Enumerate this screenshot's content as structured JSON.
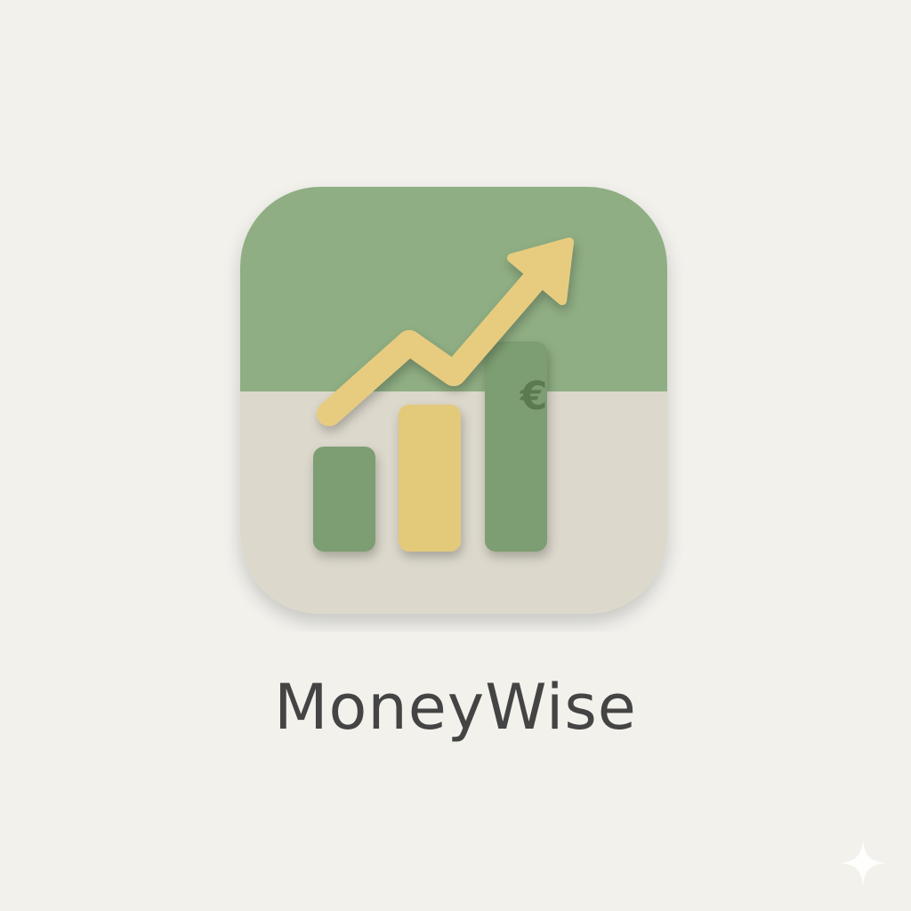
{
  "app": {
    "name": "MoneyWise",
    "currency_symbol": "€"
  },
  "icon": {
    "motif": "bar-chart-with-rising-arrow-icon",
    "currency_icon": "euro-icon",
    "corner_icon": "sparkle-icon"
  },
  "chart_data": {
    "type": "bar",
    "categories": [
      "",
      "",
      ""
    ],
    "values": [
      1,
      1.4,
      2
    ]
  },
  "colors": {
    "background": "#f2f1ec",
    "icon_top_green": "#8fae83",
    "icon_bottom_beige": "#dcd8cc",
    "bar_green": "#7d9e72",
    "bar_yellow": "#e3c97a",
    "arrow_yellow": "#e7cc80",
    "euro_engraving": "#5c7a52",
    "title_text": "#444444",
    "sparkle": "#ffffff"
  }
}
